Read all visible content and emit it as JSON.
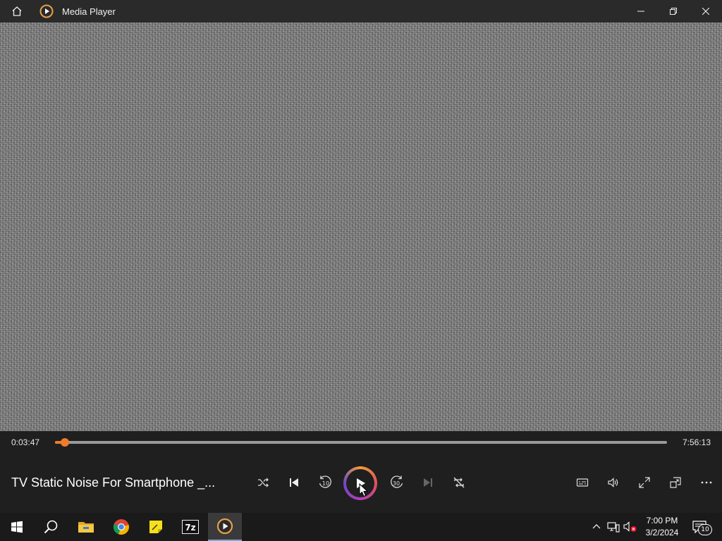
{
  "app": {
    "title": "Media Player"
  },
  "player": {
    "elapsed": "0:03:47",
    "total": "7:56:13",
    "progress_fraction": 0.0048,
    "track_title": "TV Static Noise For Smartphone _...",
    "rewind_seconds": "10",
    "forward_seconds": "30",
    "accent_color": "#f07b2b"
  },
  "taskbar": {
    "time": "7:00 PM",
    "date": "3/2/2024",
    "notifications_count": "10",
    "apps": [
      {
        "name": "start-icon"
      },
      {
        "name": "search-icon"
      },
      {
        "name": "file-explorer-icon"
      },
      {
        "name": "chrome-icon"
      },
      {
        "name": "sticky-notes-icon"
      },
      {
        "name": "7zip-icon",
        "label": "7z"
      },
      {
        "name": "media-player-icon"
      }
    ]
  }
}
